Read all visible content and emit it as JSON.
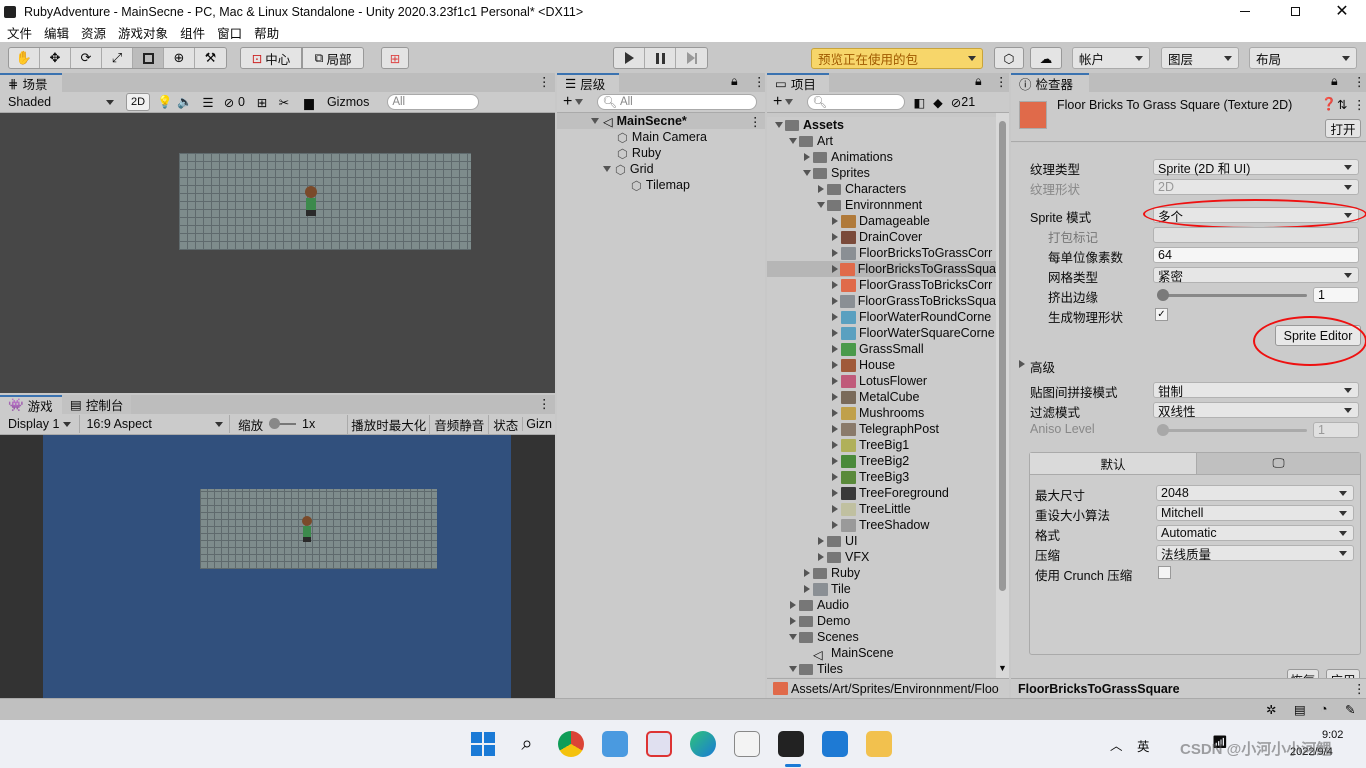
{
  "window": {
    "title": "RubyAdventure - MainSecne - PC, Mac & Linux Standalone - Unity 2020.3.23f1c1 Personal* <DX11>"
  },
  "menu": [
    "文件",
    "编辑",
    "资源",
    "游戏对象",
    "组件",
    "窗口",
    "帮助"
  ],
  "toolbar": {
    "pivot_label": "中心",
    "space_label": "局部",
    "packages_label": "预览正在使用的包",
    "account_label": "帐户",
    "layers_label": "图层",
    "layout_label": "布局"
  },
  "scene": {
    "tab": "场景",
    "shading": "Shaded",
    "mode2d": "2D",
    "hidden_count": "0",
    "gizmos": "Gizmos",
    "search_placeholder": "All"
  },
  "game": {
    "tab": "游戏",
    "console_tab": "控制台",
    "display": "Display 1",
    "aspect": "16:9 Aspect",
    "scale_label": "缩放",
    "scale_value": "1x",
    "maximize": "播放时最大化",
    "mute": "音频静音",
    "stats": "状态",
    "gizmos": "Gizn"
  },
  "hierarchy": {
    "tab": "层级",
    "search_placeholder": "All",
    "scene": "MainSecne*",
    "items": [
      "Main Camera",
      "Ruby",
      "Grid",
      "Tilemap"
    ]
  },
  "project": {
    "tab": "项目",
    "search_placeholder": "",
    "badge": "21",
    "tree": [
      {
        "label": "Assets",
        "depth": 0,
        "open": true,
        "kind": "folder",
        "bold": true
      },
      {
        "label": "Art",
        "depth": 1,
        "open": true,
        "kind": "folder"
      },
      {
        "label": "Animations",
        "depth": 2,
        "open": false,
        "kind": "folder"
      },
      {
        "label": "Sprites",
        "depth": 2,
        "open": true,
        "kind": "folder"
      },
      {
        "label": "Characters",
        "depth": 3,
        "open": false,
        "kind": "folder"
      },
      {
        "label": "Environnment",
        "depth": 3,
        "open": true,
        "kind": "folder"
      },
      {
        "label": "Damageable",
        "depth": 4,
        "open": false,
        "kind": "asset",
        "color": "#b07a3a"
      },
      {
        "label": "DrainCover",
        "depth": 4,
        "open": false,
        "kind": "asset",
        "color": "#7a4a3a"
      },
      {
        "label": "FloorBricksToGrassCorr",
        "depth": 4,
        "open": false,
        "kind": "asset",
        "color": "#8a8f94"
      },
      {
        "label": "FloorBricksToGrassSqua",
        "depth": 4,
        "open": false,
        "kind": "asset",
        "color": "#e06a4a",
        "selected": true
      },
      {
        "label": "FloorGrassToBricksCorr",
        "depth": 4,
        "open": false,
        "kind": "asset",
        "color": "#e06a4a"
      },
      {
        "label": "FloorGrassToBricksSqua",
        "depth": 4,
        "open": false,
        "kind": "asset",
        "color": "#8a8f94"
      },
      {
        "label": "FloorWaterRoundCorne",
        "depth": 4,
        "open": false,
        "kind": "asset",
        "color": "#5aa0c0"
      },
      {
        "label": "FloorWaterSquareCorne",
        "depth": 4,
        "open": false,
        "kind": "asset",
        "color": "#5aa0c0"
      },
      {
        "label": "GrassSmall",
        "depth": 4,
        "open": false,
        "kind": "asset",
        "color": "#4a9a4a"
      },
      {
        "label": "House",
        "depth": 4,
        "open": false,
        "kind": "asset",
        "color": "#a05a3a"
      },
      {
        "label": "LotusFlower",
        "depth": 4,
        "open": false,
        "kind": "asset",
        "color": "#c05a7a"
      },
      {
        "label": "MetalCube",
        "depth": 4,
        "open": false,
        "kind": "asset",
        "color": "#7a6a5a"
      },
      {
        "label": "Mushrooms",
        "depth": 4,
        "open": false,
        "kind": "asset",
        "color": "#c0a04a"
      },
      {
        "label": "TelegraphPost",
        "depth": 4,
        "open": false,
        "kind": "asset",
        "color": "#8a7a6a"
      },
      {
        "label": "TreeBig1",
        "depth": 4,
        "open": false,
        "kind": "asset",
        "color": "#b0b05a"
      },
      {
        "label": "TreeBig2",
        "depth": 4,
        "open": false,
        "kind": "asset",
        "color": "#4a8a3a"
      },
      {
        "label": "TreeBig3",
        "depth": 4,
        "open": false,
        "kind": "asset",
        "color": "#5a8a3a"
      },
      {
        "label": "TreeForeground",
        "depth": 4,
        "open": false,
        "kind": "asset",
        "color": "#3a3a3a"
      },
      {
        "label": "TreeLittle",
        "depth": 4,
        "open": false,
        "kind": "asset",
        "color": "#c0c0a0"
      },
      {
        "label": "TreeShadow",
        "depth": 4,
        "open": false,
        "kind": "asset",
        "color": "#9a9a9a"
      },
      {
        "label": "UI",
        "depth": 3,
        "open": false,
        "kind": "folder"
      },
      {
        "label": "VFX",
        "depth": 3,
        "open": false,
        "kind": "folder"
      },
      {
        "label": "Ruby",
        "depth": 2,
        "open": false,
        "kind": "folder"
      },
      {
        "label": "Tile",
        "depth": 2,
        "open": false,
        "kind": "asset",
        "color": "#8a8f94"
      },
      {
        "label": "Audio",
        "depth": 1,
        "open": false,
        "kind": "folder"
      },
      {
        "label": "Demo",
        "depth": 1,
        "open": false,
        "kind": "folder"
      },
      {
        "label": "Scenes",
        "depth": 1,
        "open": true,
        "kind": "folder"
      },
      {
        "label": "MainScene",
        "depth": 2,
        "open": null,
        "kind": "scene"
      },
      {
        "label": "Tiles",
        "depth": 1,
        "open": true,
        "kind": "folder"
      }
    ],
    "path": "Assets/Art/Sprites/Environnment/Floo"
  },
  "inspector": {
    "tab": "检查器",
    "title": "Floor Bricks To Grass Square (Texture 2D)",
    "open_button": "打开",
    "texture_type_label": "纹理类型",
    "texture_type": "Sprite (2D 和 UI)",
    "texture_shape_label": "纹理形状",
    "texture_shape": "2D",
    "sprite_mode_label": "Sprite 模式",
    "sprite_mode": "多个",
    "packing_tag_label": "打包标记",
    "packing_tag": "",
    "ppu_label": "每单位像素数",
    "ppu": "64",
    "mesh_type_label": "网格类型",
    "mesh_type": "紧密",
    "extrude_label": "挤出边缘",
    "extrude": "1",
    "extrude_fraction": 0.0,
    "physics_label": "生成物理形状",
    "sprite_editor_button": "Sprite Editor",
    "advanced_label": "高级",
    "wrap_label": "贴图间拼接模式",
    "wrap": "钳制",
    "filter_label": "过滤模式",
    "filter": "双线性",
    "aniso_label": "Aniso Level",
    "aniso": "1",
    "platform_default_tab": "默认",
    "max_size_label": "最大尺寸",
    "max_size": "2048",
    "resize_label": "重设大小算法",
    "resize": "Mitchell",
    "format_label": "格式",
    "format": "Automatic",
    "compression_label": "压缩",
    "compression": "法线质量",
    "crunch_label": "使用 Crunch 压缩",
    "revert_button": "恢复",
    "apply_button": "应用",
    "footer_name": "FloorBricksToGrassSquare"
  },
  "taskbar": {
    "ime": "英",
    "time": "9:02",
    "date": "2022/9/4",
    "watermark": "CSDN @小河小小河鲤"
  }
}
